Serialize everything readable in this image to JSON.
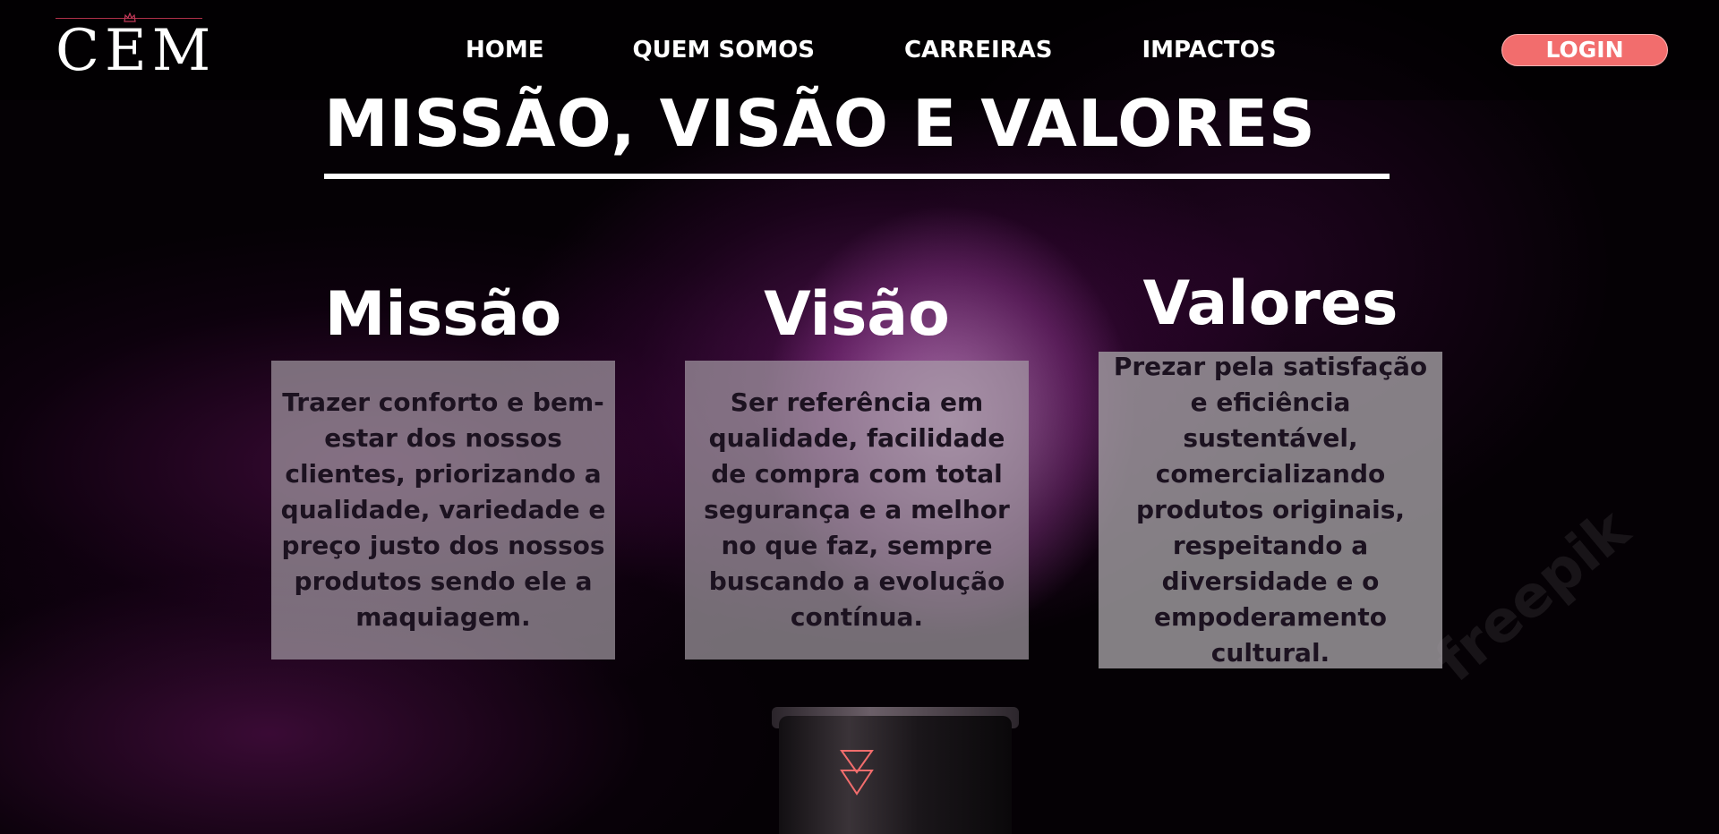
{
  "header": {
    "logo_text": "CEM",
    "nav": [
      "HOME",
      "QUEM SOMOS",
      "CARREIRAS",
      "IMPACTOS"
    ],
    "login_label": "LOGIN"
  },
  "main": {
    "title": "MISSÃO, VISÃO E VALORES",
    "columns": [
      {
        "heading": "Missão",
        "text": "Trazer conforto e bem-estar dos nossos clientes, priorizando a qualidade, variedade e preço justo dos nossos produtos sendo ele a maquiagem."
      },
      {
        "heading": "Visão",
        "text": "Ser referência em qualidade, facilidade de compra com total segurança e a melhor no que faz, sempre buscando a evolução contínua."
      },
      {
        "heading": "Valores",
        "text": "Prezar pela satisfação e eficiência sustentável, comercializando produtos originais, respeitando a diversidade e o empoderamento cultural."
      }
    ]
  },
  "background": {
    "watermark": "freepik"
  },
  "colors": {
    "accent": "#f26d6d",
    "logo_line": "#b0304a",
    "powder": "#a02aa0"
  },
  "icons": {
    "scroll": "double-chevron-down-icon",
    "crown": "crown-icon"
  }
}
